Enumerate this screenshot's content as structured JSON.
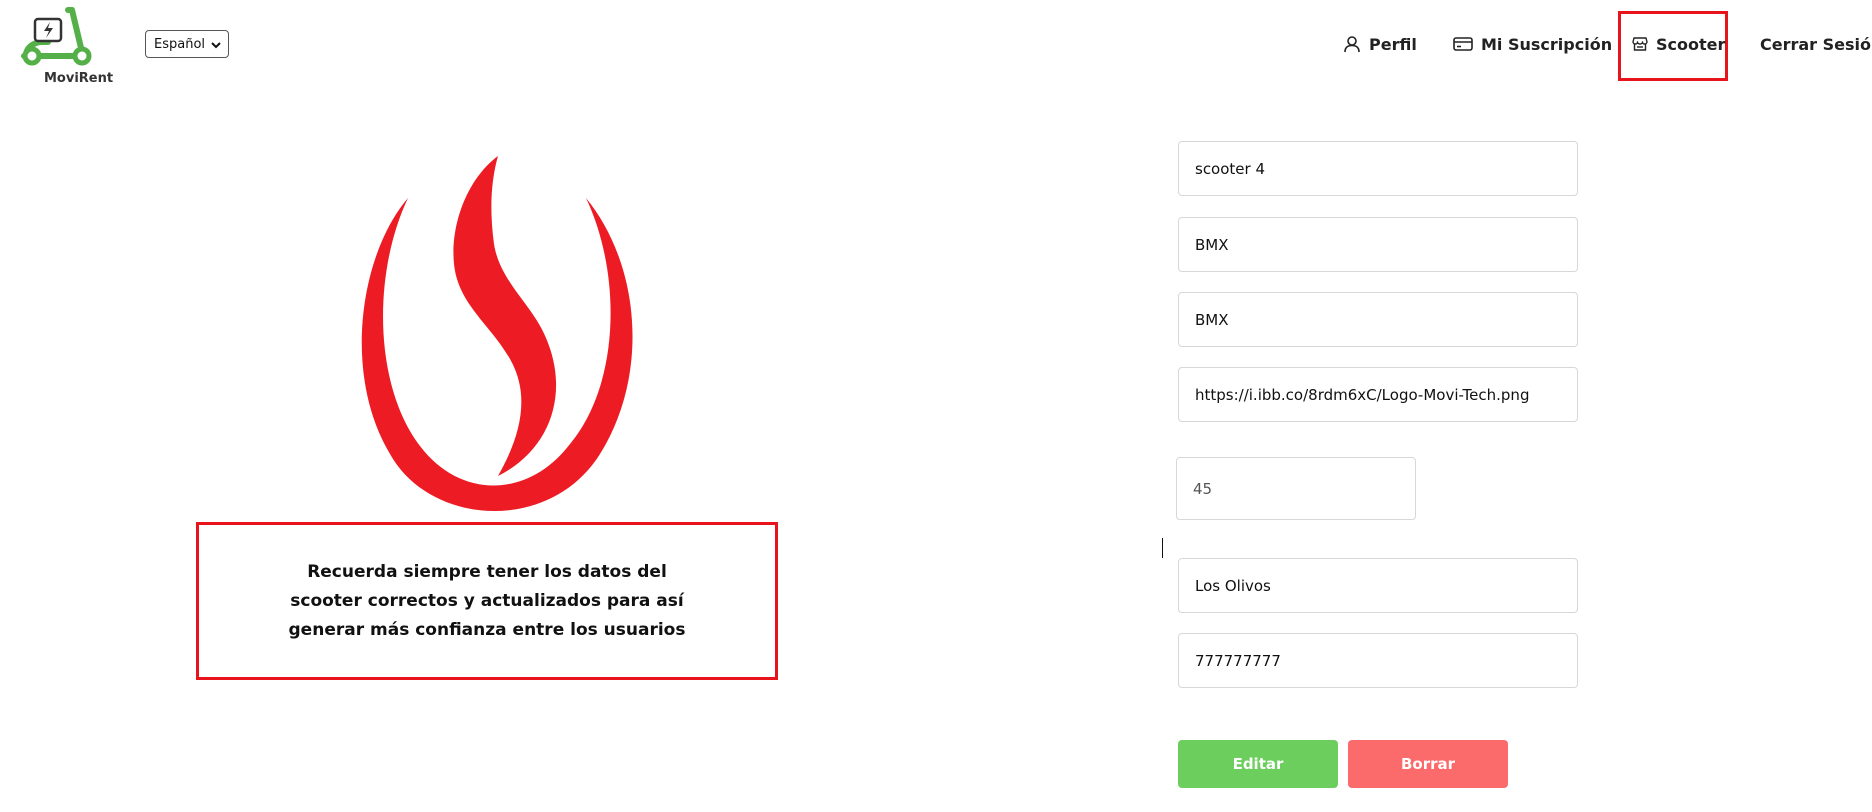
{
  "brand": {
    "name": "MoviRent",
    "logo_icon": "electric-scooter-icon",
    "accent": "#55b04a"
  },
  "language_select": {
    "selected": "Español"
  },
  "nav": {
    "profile": "Perfil",
    "subscription": "Mi Suscripción",
    "scooter": "Scooter",
    "logout": "Cerrar Sesión"
  },
  "notice": {
    "text": "Recuerda siempre tener los datos del scooter correctos y actualizados para así generar más confianza entre los usuarios",
    "border_color": "#e8141c"
  },
  "form": {
    "name": "scooter 4",
    "brand": "BMX",
    "model": "BMX",
    "image_url": "https://i.ibb.co/8rdm6xC/Logo-Movi-Tech.png",
    "price": "45",
    "location": "Los Olivos",
    "phone": "777777777",
    "edit_label": "Editar",
    "delete_label": "Borrar",
    "edit_color": "#6ccf5d",
    "delete_color": "#fb6b6b"
  },
  "illustration": {
    "flame_color": "#ed1c24"
  }
}
